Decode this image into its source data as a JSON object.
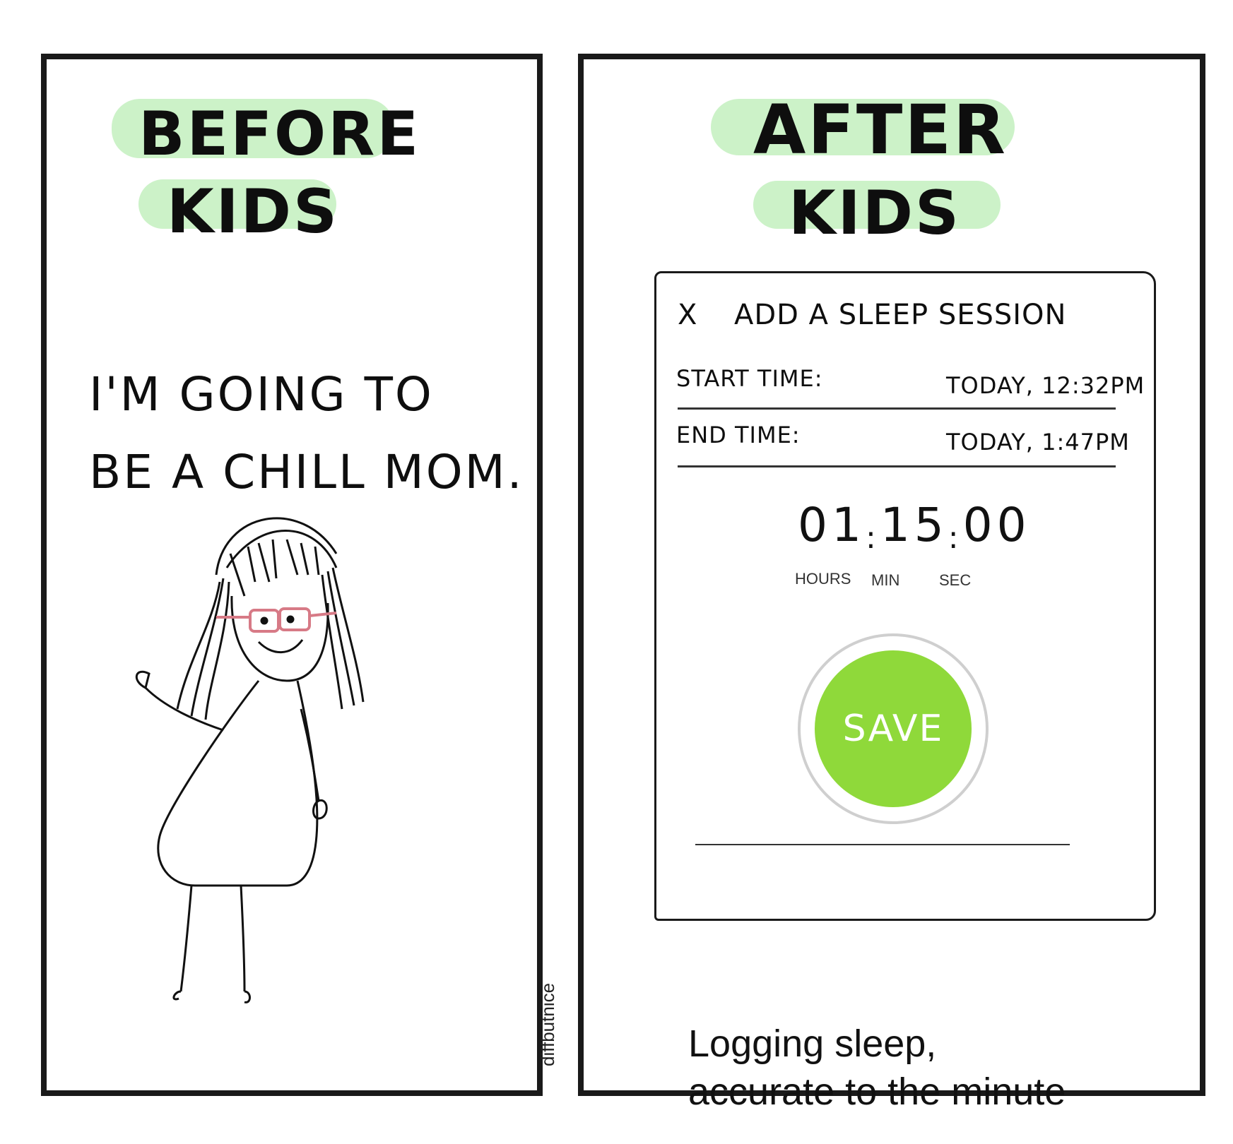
{
  "left_panel": {
    "title_line1": "BEFORE",
    "title_line2": "KIDS",
    "quote_line1": "I'M GOING TO",
    "quote_line2": "BE A CHILL MOM."
  },
  "right_panel": {
    "title_line1": "AFTER",
    "title_line2": "KIDS",
    "dialog": {
      "close_label": "X",
      "title": "ADD A SLEEP SESSION",
      "start_label": "START TIME:",
      "start_value": "TODAY, 12:32PM",
      "end_label": "END TIME:",
      "end_value": "TODAY, 1:47PM",
      "timer": {
        "hours": "01",
        "minutes": "15",
        "seconds": "00",
        "separator": ":"
      },
      "units": {
        "hours": "HOURS",
        "min": "MIN",
        "sec": "SEC"
      },
      "save_label": "SAVE"
    },
    "caption_line1": "Logging sleep,",
    "caption_line2": "accurate to the minute"
  },
  "watermark": "diffbutnice",
  "colors": {
    "highlight": "#ccf2c8",
    "save_button": "#8fd93a",
    "glasses": "#d77a86"
  }
}
